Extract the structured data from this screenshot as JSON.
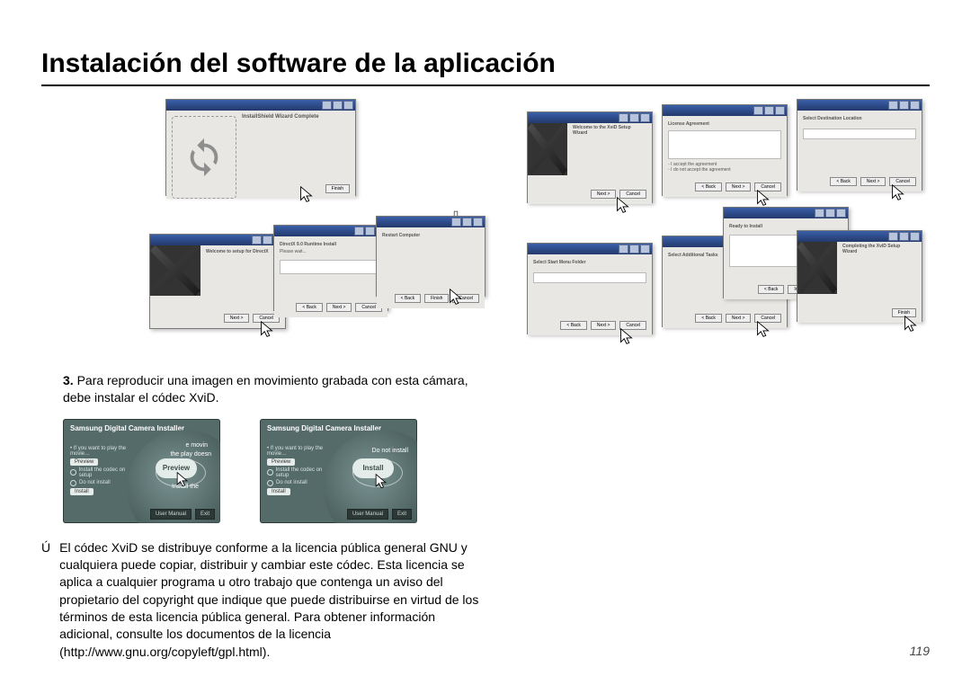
{
  "title": "Instalación del software de la aplicación",
  "page_number": "119",
  "step3": {
    "number": "3.",
    "text": "Para reproducir una imagen en movimiento grabada con esta cámara, debe instalar el códec XviD."
  },
  "footnote": {
    "marker": "Ú",
    "text": "El códec XviD se distribuye conforme a la licencia pública general GNU y cualquiera puede copiar, distribuir y cambiar este códec. Esta licencia se aplica a cualquier programa u otro trabajo que contenga un aviso del propietario del copyright que indique que puede distribuirse en virtud de los términos de esta licencia pública general. Para obtener información adicional, consulte los documentos de la licencia (http://www.gnu.org/copyleft/gpl.html)."
  },
  "installer": {
    "header": "Samsung Digital Camera Installer",
    "preview_btn": "Preview",
    "install_btn": "Install",
    "left_sub_top": "e movin",
    "left_sub_bottom1": "the play doesn",
    "left_sub_bottom2": "Install the",
    "right_sub_top": "Do not install",
    "footer_left": "User Manual",
    "footer_right": "Exit"
  },
  "left_windows": {
    "w1_title": "InstallShield Wizard Complete",
    "w2_title": "Welcome to setup for DirectX",
    "w3_title1": "DirectX 9.0 Runtime Install",
    "w3_title2": "Please wait...",
    "w4_title": "Restart Computer"
  },
  "right_windows": {
    "r1_title": "Welcome to the XviD Setup Wizard",
    "r2_title": "License Agreement",
    "r3_title": "Select Destination Location",
    "r4_title": "Select Start Menu Folder",
    "r5_title": "Select Additional Tasks",
    "r6_title": "Ready to Install",
    "r7_title": "Completing the XviD Setup Wizard"
  },
  "generic_btn_back": "< Back",
  "generic_btn_next": "Next >",
  "generic_btn_cancel": "Cancel",
  "generic_btn_finish": "Finish",
  "generic_btn_install": "Install"
}
